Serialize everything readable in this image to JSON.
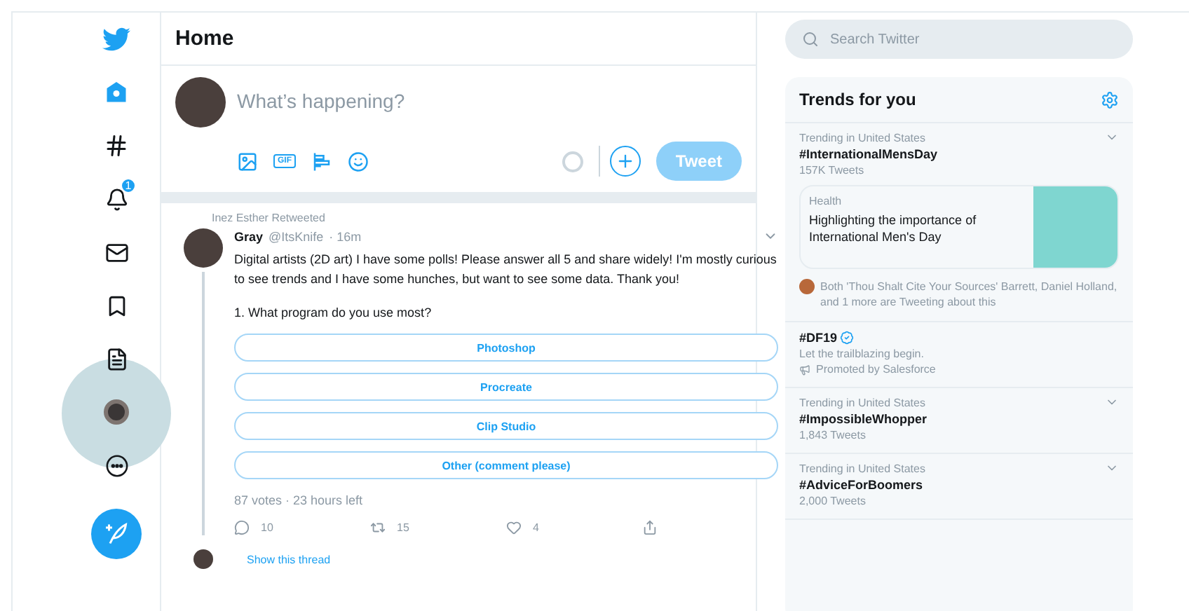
{
  "nav": {
    "items": [
      {
        "kind": "logo",
        "selected": false,
        "pressed": false
      },
      {
        "kind": "home",
        "selected": true,
        "pressed": false
      },
      {
        "kind": "explore",
        "selected": false,
        "pressed": false
      },
      {
        "kind": "notifications",
        "selected": false,
        "pressed": false,
        "badge": "1"
      },
      {
        "kind": "messages",
        "selected": false,
        "pressed": false
      },
      {
        "kind": "bookmarks",
        "selected": false,
        "pressed": false
      },
      {
        "kind": "lists",
        "selected": false,
        "pressed": false
      },
      {
        "kind": "profile",
        "selected": false,
        "pressed": true
      },
      {
        "kind": "more",
        "selected": false,
        "pressed": false
      }
    ]
  },
  "header": {
    "title": "Home"
  },
  "compose": {
    "placeholder": "What’s happening?",
    "gif_label": "GIF",
    "button": "Tweet",
    "button_disabled": true
  },
  "tweet": {
    "context": "Inez Esther Retweeted",
    "name": "Gray",
    "handle": "@ItsKnife",
    "time": "· 16m",
    "text": "Digital artists (2D art) I have some polls! Please answer all 5 and share widely! I'm mostly curious to see trends and I have some hunches, but want to see some data. Thank you!",
    "question": "1. What program do you use most?",
    "options": [
      "Photoshop",
      "Procreate",
      "Clip Studio",
      "Other (comment please)"
    ],
    "poll_info": "87 votes · 23 hours left",
    "replies": "10",
    "retweets": "15",
    "likes": "4",
    "thread_link": "Show this thread"
  },
  "search": {
    "placeholder": "Search Twitter"
  },
  "trends": {
    "title": "Trends for you",
    "items": [
      {
        "kind": "trend",
        "context": "Trending in United States",
        "name": "#InternationalMensDay",
        "count": "157K Tweets",
        "card": {
          "category": "Health",
          "headline": "Highlighting the importance of International Men's Day"
        },
        "tweeting": "Both 'Thou Shalt Cite Your Sources' Barrett, Daniel Holland, and 1 more are Tweeting about this"
      },
      {
        "kind": "promoted",
        "name": "#DF19",
        "description": "Let the trailblazing begin.",
        "promoter": "Promoted by Salesforce"
      },
      {
        "kind": "trend",
        "context": "Trending in United States",
        "name": "#ImpossibleWhopper",
        "count": "1,843 Tweets"
      },
      {
        "kind": "trend",
        "context": "Trending in United States",
        "name": "#AdviceForBoomers",
        "count": "2,000 Tweets"
      }
    ]
  }
}
